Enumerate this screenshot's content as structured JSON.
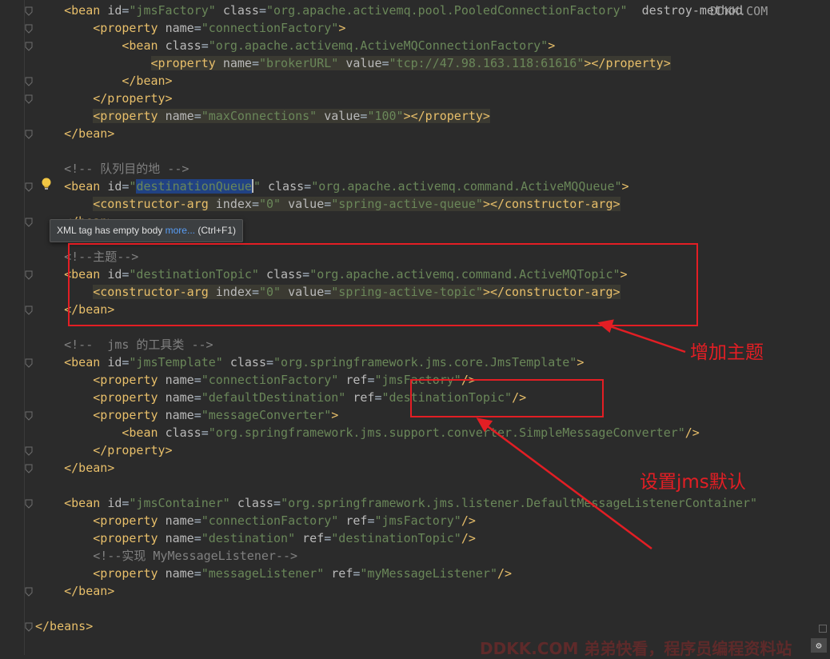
{
  "editor": {
    "lines": [
      {
        "id": 1,
        "indent": "    ",
        "tokens": [
          {
            "t": "<bean ",
            "c": "tg"
          },
          {
            "t": "id",
            "c": "an"
          },
          {
            "t": "=",
            "c": "tx"
          },
          {
            "t": "\"jmsFactory\"",
            "c": "av"
          },
          {
            "t": " ",
            "c": "tx"
          },
          {
            "t": "class",
            "c": "an"
          },
          {
            "t": "=",
            "c": "tx"
          },
          {
            "t": "\"org.apache.activemq.pool.PooledConnectionFactory\"",
            "c": "av"
          },
          {
            "t": "  destroy-method",
            "c": "an"
          }
        ]
      },
      {
        "id": 2,
        "indent": "        ",
        "tokens": [
          {
            "t": "<property ",
            "c": "tg"
          },
          {
            "t": "name",
            "c": "an"
          },
          {
            "t": "=",
            "c": "tx"
          },
          {
            "t": "\"connectionFactory\"",
            "c": "av"
          },
          {
            "t": ">",
            "c": "tg"
          }
        ]
      },
      {
        "id": 3,
        "indent": "            ",
        "tokens": [
          {
            "t": "<bean ",
            "c": "tg"
          },
          {
            "t": "class",
            "c": "an"
          },
          {
            "t": "=",
            "c": "tx"
          },
          {
            "t": "\"org.apache.activemq.ActiveMQConnectionFactory\"",
            "c": "av"
          },
          {
            "t": ">",
            "c": "tg"
          }
        ]
      },
      {
        "id": 4,
        "indent": "                ",
        "hl": true,
        "tokens": [
          {
            "t": "<property ",
            "c": "tg"
          },
          {
            "t": "name",
            "c": "an"
          },
          {
            "t": "=",
            "c": "tx"
          },
          {
            "t": "\"brokerURL\"",
            "c": "av"
          },
          {
            "t": " ",
            "c": "tx"
          },
          {
            "t": "value",
            "c": "an"
          },
          {
            "t": "=",
            "c": "tx"
          },
          {
            "t": "\"tcp://47.98.163.118:61616\"",
            "c": "av"
          },
          {
            "t": "></property>",
            "c": "tg"
          }
        ]
      },
      {
        "id": 5,
        "indent": "            ",
        "tokens": [
          {
            "t": "</bean>",
            "c": "tg"
          }
        ]
      },
      {
        "id": 6,
        "indent": "        ",
        "tokens": [
          {
            "t": "</property>",
            "c": "tg"
          }
        ]
      },
      {
        "id": 7,
        "indent": "        ",
        "hl": true,
        "tokens": [
          {
            "t": "<property ",
            "c": "tg"
          },
          {
            "t": "name",
            "c": "an"
          },
          {
            "t": "=",
            "c": "tx"
          },
          {
            "t": "\"maxConnections\"",
            "c": "av"
          },
          {
            "t": " ",
            "c": "tx"
          },
          {
            "t": "value",
            "c": "an"
          },
          {
            "t": "=",
            "c": "tx"
          },
          {
            "t": "\"100\"",
            "c": "av"
          },
          {
            "t": "></property>",
            "c": "tg"
          }
        ]
      },
      {
        "id": 8,
        "indent": "    ",
        "tokens": [
          {
            "t": "</bean>",
            "c": "tg"
          }
        ]
      },
      {
        "id": 9,
        "indent": "",
        "tokens": []
      },
      {
        "id": 10,
        "indent": "    ",
        "tokens": [
          {
            "t": "<!-- 队列目的地 -->",
            "c": "cm"
          }
        ]
      },
      {
        "id": 11,
        "indent": "    ",
        "tokens": [
          {
            "t": "<bean ",
            "c": "tg"
          },
          {
            "t": "id",
            "c": "an"
          },
          {
            "t": "=",
            "c": "tx"
          },
          {
            "t": "\"",
            "c": "av"
          },
          {
            "t": "destinationQueue",
            "c": "av",
            "sel": true
          },
          {
            "t": "CARET",
            "c": "caret"
          },
          {
            "t": "\"",
            "c": "av"
          },
          {
            "t": " ",
            "c": "tx"
          },
          {
            "t": "class",
            "c": "an"
          },
          {
            "t": "=",
            "c": "tx"
          },
          {
            "t": "\"org.apache.activemq.command.ActiveMQQueue\"",
            "c": "av"
          },
          {
            "t": ">",
            "c": "tg"
          }
        ]
      },
      {
        "id": 12,
        "indent": "        ",
        "hl": true,
        "tokens": [
          {
            "t": "<constructor-arg ",
            "c": "tg"
          },
          {
            "t": "index",
            "c": "an"
          },
          {
            "t": "=",
            "c": "tx"
          },
          {
            "t": "\"0\"",
            "c": "av"
          },
          {
            "t": " ",
            "c": "tx"
          },
          {
            "t": "value",
            "c": "an"
          },
          {
            "t": "=",
            "c": "tx"
          },
          {
            "t": "\"spring-active-queue\"",
            "c": "av"
          },
          {
            "t": "></constructor-arg>",
            "c": "tg"
          }
        ]
      },
      {
        "id": 13,
        "indent": "    ",
        "tokens": [
          {
            "t": "</bean>",
            "c": "tg"
          }
        ]
      },
      {
        "id": 14,
        "indent": "",
        "tokens": []
      },
      {
        "id": 15,
        "indent": "    ",
        "tokens": [
          {
            "t": "<!--主题-->",
            "c": "cm"
          }
        ]
      },
      {
        "id": 16,
        "indent": "    ",
        "tokens": [
          {
            "t": "<bean ",
            "c": "tg"
          },
          {
            "t": "id",
            "c": "an"
          },
          {
            "t": "=",
            "c": "tx"
          },
          {
            "t": "\"destinationTopic\"",
            "c": "av"
          },
          {
            "t": " ",
            "c": "tx"
          },
          {
            "t": "class",
            "c": "an"
          },
          {
            "t": "=",
            "c": "tx"
          },
          {
            "t": "\"org.apache.activemq.command.ActiveMQTopic\"",
            "c": "av"
          },
          {
            "t": ">",
            "c": "tg"
          }
        ]
      },
      {
        "id": 17,
        "indent": "        ",
        "hl": true,
        "tokens": [
          {
            "t": "<constructor-arg ",
            "c": "tg"
          },
          {
            "t": "index",
            "c": "an"
          },
          {
            "t": "=",
            "c": "tx"
          },
          {
            "t": "\"0\"",
            "c": "av"
          },
          {
            "t": " ",
            "c": "tx"
          },
          {
            "t": "value",
            "c": "an"
          },
          {
            "t": "=",
            "c": "tx"
          },
          {
            "t": "\"spring-active-topic\"",
            "c": "av"
          },
          {
            "t": "></constructor-arg>",
            "c": "tg"
          }
        ]
      },
      {
        "id": 18,
        "indent": "    ",
        "tokens": [
          {
            "t": "</bean>",
            "c": "tg"
          }
        ]
      },
      {
        "id": 19,
        "indent": "",
        "tokens": []
      },
      {
        "id": 20,
        "indent": "    ",
        "tokens": [
          {
            "t": "<!--  jms 的工具类 -->",
            "c": "cm"
          }
        ]
      },
      {
        "id": 21,
        "indent": "    ",
        "tokens": [
          {
            "t": "<bean ",
            "c": "tg"
          },
          {
            "t": "id",
            "c": "an"
          },
          {
            "t": "=",
            "c": "tx"
          },
          {
            "t": "\"jmsTemplate\"",
            "c": "av"
          },
          {
            "t": " ",
            "c": "tx"
          },
          {
            "t": "class",
            "c": "an"
          },
          {
            "t": "=",
            "c": "tx"
          },
          {
            "t": "\"org.springframework.jms.core.JmsTemplate\"",
            "c": "av"
          },
          {
            "t": ">",
            "c": "tg"
          }
        ]
      },
      {
        "id": 22,
        "indent": "        ",
        "tokens": [
          {
            "t": "<property ",
            "c": "tg"
          },
          {
            "t": "name",
            "c": "an"
          },
          {
            "t": "=",
            "c": "tx"
          },
          {
            "t": "\"connectionFactory\"",
            "c": "av"
          },
          {
            "t": " ",
            "c": "tx"
          },
          {
            "t": "ref",
            "c": "an"
          },
          {
            "t": "=",
            "c": "tx"
          },
          {
            "t": "\"jmsFactory\"",
            "c": "av"
          },
          {
            "t": "/>",
            "c": "tg"
          }
        ]
      },
      {
        "id": 23,
        "indent": "        ",
        "tokens": [
          {
            "t": "<property ",
            "c": "tg"
          },
          {
            "t": "name",
            "c": "an"
          },
          {
            "t": "=",
            "c": "tx"
          },
          {
            "t": "\"defaultDestination\"",
            "c": "av"
          },
          {
            "t": " ",
            "c": "tx"
          },
          {
            "t": "ref",
            "c": "an"
          },
          {
            "t": "=",
            "c": "tx"
          },
          {
            "t": "\"destinationTopic\"",
            "c": "av"
          },
          {
            "t": "/>",
            "c": "tg"
          }
        ]
      },
      {
        "id": 24,
        "indent": "        ",
        "tokens": [
          {
            "t": "<property ",
            "c": "tg"
          },
          {
            "t": "name",
            "c": "an"
          },
          {
            "t": "=",
            "c": "tx"
          },
          {
            "t": "\"messageConverter\"",
            "c": "av"
          },
          {
            "t": ">",
            "c": "tg"
          }
        ]
      },
      {
        "id": 25,
        "indent": "            ",
        "tokens": [
          {
            "t": "<bean ",
            "c": "tg"
          },
          {
            "t": "class",
            "c": "an"
          },
          {
            "t": "=",
            "c": "tx"
          },
          {
            "t": "\"org.springframework.jms.support.converter.SimpleMessageConverter\"",
            "c": "av"
          },
          {
            "t": "/>",
            "c": "tg"
          }
        ]
      },
      {
        "id": 26,
        "indent": "        ",
        "tokens": [
          {
            "t": "</property>",
            "c": "tg"
          }
        ]
      },
      {
        "id": 27,
        "indent": "    ",
        "tokens": [
          {
            "t": "</bean>",
            "c": "tg"
          }
        ]
      },
      {
        "id": 28,
        "indent": "",
        "tokens": []
      },
      {
        "id": 29,
        "indent": "    ",
        "tokens": [
          {
            "t": "<bean ",
            "c": "tg"
          },
          {
            "t": "id",
            "c": "an"
          },
          {
            "t": "=",
            "c": "tx"
          },
          {
            "t": "\"jmsContainer\"",
            "c": "av"
          },
          {
            "t": " ",
            "c": "tx"
          },
          {
            "t": "class",
            "c": "an"
          },
          {
            "t": "=",
            "c": "tx"
          },
          {
            "t": "\"org.springframework.jms.listener.DefaultMessageListenerContainer\"",
            "c": "av"
          }
        ]
      },
      {
        "id": 30,
        "indent": "        ",
        "tokens": [
          {
            "t": "<property ",
            "c": "tg"
          },
          {
            "t": "name",
            "c": "an"
          },
          {
            "t": "=",
            "c": "tx"
          },
          {
            "t": "\"connectionFactory\"",
            "c": "av"
          },
          {
            "t": " ",
            "c": "tx"
          },
          {
            "t": "ref",
            "c": "an"
          },
          {
            "t": "=",
            "c": "tx"
          },
          {
            "t": "\"jmsFactory\"",
            "c": "av"
          },
          {
            "t": "/>",
            "c": "tg"
          }
        ]
      },
      {
        "id": 31,
        "indent": "        ",
        "tokens": [
          {
            "t": "<property ",
            "c": "tg"
          },
          {
            "t": "name",
            "c": "an"
          },
          {
            "t": "=",
            "c": "tx"
          },
          {
            "t": "\"destination\"",
            "c": "av"
          },
          {
            "t": " ",
            "c": "tx"
          },
          {
            "t": "ref",
            "c": "an"
          },
          {
            "t": "=",
            "c": "tx"
          },
          {
            "t": "\"destinationTopic\"",
            "c": "av"
          },
          {
            "t": "/>",
            "c": "tg"
          }
        ]
      },
      {
        "id": 32,
        "indent": "        ",
        "tokens": [
          {
            "t": "<!--实现 MyMessageListener-->",
            "c": "cm"
          }
        ]
      },
      {
        "id": 33,
        "indent": "        ",
        "tokens": [
          {
            "t": "<property ",
            "c": "tg"
          },
          {
            "t": "name",
            "c": "an"
          },
          {
            "t": "=",
            "c": "tx"
          },
          {
            "t": "\"messageListener\"",
            "c": "av"
          },
          {
            "t": " ",
            "c": "tx"
          },
          {
            "t": "ref",
            "c": "an"
          },
          {
            "t": "=",
            "c": "tx"
          },
          {
            "t": "\"myMessageListener\"",
            "c": "av"
          },
          {
            "t": "/>",
            "c": "tg"
          }
        ]
      },
      {
        "id": 34,
        "indent": "    ",
        "tokens": [
          {
            "t": "</bean>",
            "c": "tg"
          }
        ]
      },
      {
        "id": 35,
        "indent": "",
        "tokens": []
      },
      {
        "id": 36,
        "indent": "",
        "tokens": [
          {
            "t": "</beans>",
            "c": "tg"
          }
        ]
      }
    ],
    "folded_lines": [
      1,
      2,
      3,
      5,
      6,
      8,
      11,
      13,
      16,
      18,
      21,
      24,
      26,
      27,
      29,
      34,
      36
    ]
  },
  "tooltip": {
    "message": "XML tag has empty body ",
    "link": "more...",
    "shortcut": " (Ctrl+F1)"
  },
  "annotations": {
    "topic_label": "增加主题",
    "default_label": "设置jms默认",
    "color": "#e31e24"
  },
  "watermarks": {
    "top": "DDKK.COM",
    "bottom": "DDKK.COM 弟弟快看，程序员编程资料站"
  },
  "icons": {
    "bulb": "lightbulb-icon",
    "corner": "corner-icon"
  }
}
